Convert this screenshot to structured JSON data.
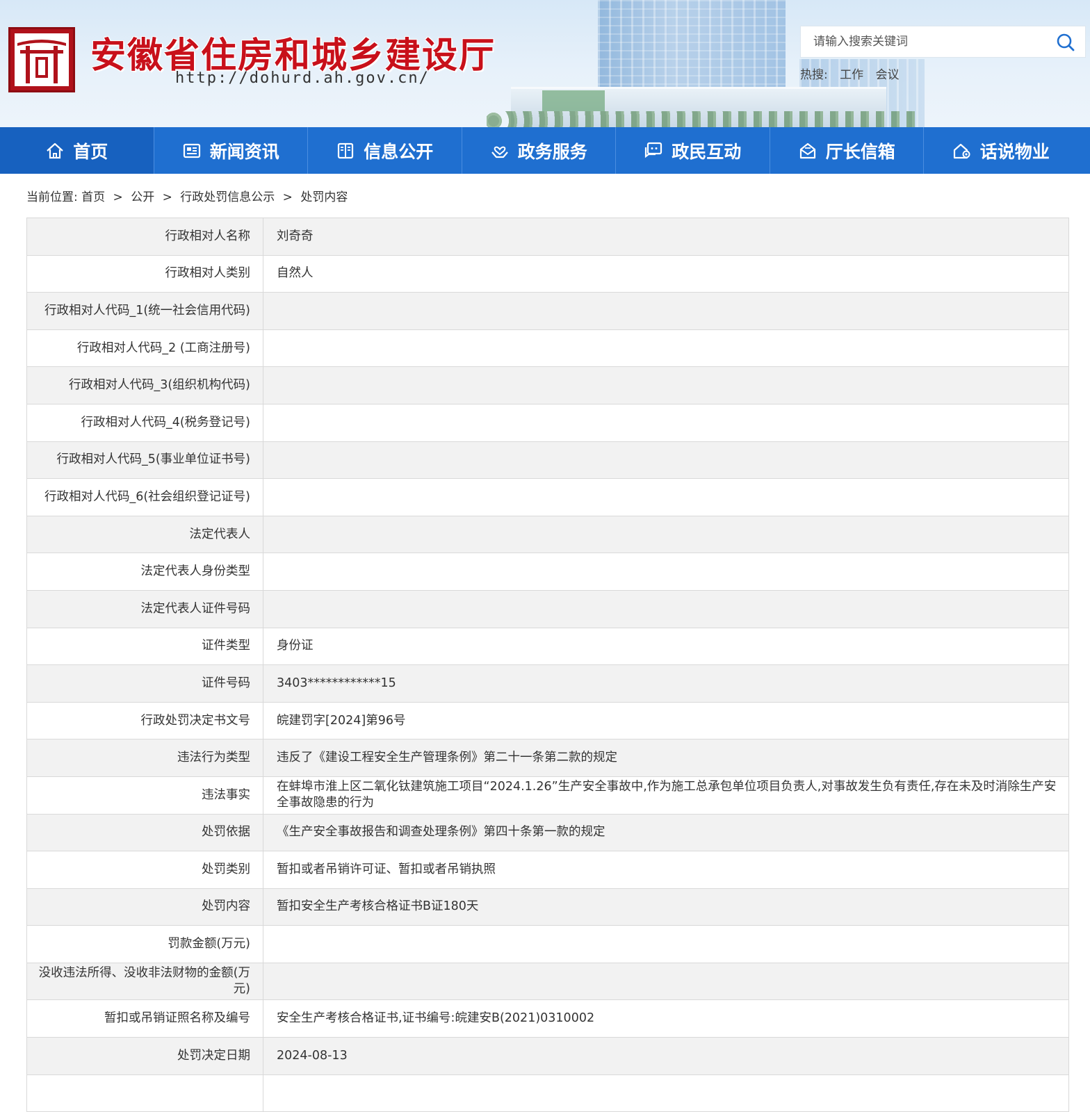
{
  "header": {
    "site_title": "安徽省住房和城乡建设厅",
    "site_url": "http://dohurd.ah.gov.cn/",
    "search_placeholder": "请输入搜索关键词",
    "hot_label": "热搜:",
    "hot_items": [
      "工作",
      "会议"
    ]
  },
  "nav": {
    "items": [
      {
        "label": "首页",
        "icon": "home-icon"
      },
      {
        "label": "新闻资讯",
        "icon": "news-icon"
      },
      {
        "label": "信息公开",
        "icon": "book-icon"
      },
      {
        "label": "政务服务",
        "icon": "service-hands-icon"
      },
      {
        "label": "政民互动",
        "icon": "chat-icon"
      },
      {
        "label": "厅长信箱",
        "icon": "mailbox-icon"
      },
      {
        "label": "话说物业",
        "icon": "property-icon"
      }
    ],
    "active_index": 0
  },
  "breadcrumb": {
    "prefix": "当前位置:",
    "items": [
      "首页",
      "公开",
      "行政处罚信息公示",
      "处罚内容"
    ],
    "separator": ">"
  },
  "table": {
    "rows": [
      {
        "label": "行政相对人名称",
        "value": "刘奇奇"
      },
      {
        "label": "行政相对人类别",
        "value": "自然人"
      },
      {
        "label": "行政相对人代码_1(统一社会信用代码)",
        "value": ""
      },
      {
        "label": "行政相对人代码_2 (工商注册号)",
        "value": ""
      },
      {
        "label": "行政相对人代码_3(组织机构代码)",
        "value": ""
      },
      {
        "label": "行政相对人代码_4(税务登记号)",
        "value": ""
      },
      {
        "label": "行政相对人代码_5(事业单位证书号)",
        "value": ""
      },
      {
        "label": "行政相对人代码_6(社会组织登记证号)",
        "value": ""
      },
      {
        "label": "法定代表人",
        "value": ""
      },
      {
        "label": "法定代表人身份类型",
        "value": ""
      },
      {
        "label": "法定代表人证件号码",
        "value": ""
      },
      {
        "label": "证件类型",
        "value": "身份证"
      },
      {
        "label": "证件号码",
        "value": "3403************15"
      },
      {
        "label": "行政处罚决定书文号",
        "value": "皖建罚字[2024]第96号"
      },
      {
        "label": "违法行为类型",
        "value": "违反了《建设工程安全生产管理条例》第二十一条第二款的规定"
      },
      {
        "label": "违法事实",
        "value": "在蚌埠市淮上区二氧化钛建筑施工项目“2024.1.26”生产安全事故中,作为施工总承包单位项目负责人,对事故发生负有责任,存在未及时消除生产安全事故隐患的行为"
      },
      {
        "label": "处罚依据",
        "value": "《生产安全事故报告和调查处理条例》第四十条第一款的规定"
      },
      {
        "label": "处罚类别",
        "value": "暂扣或者吊销许可证、暂扣或者吊销执照"
      },
      {
        "label": "处罚内容",
        "value": "暂扣安全生产考核合格证书B证180天"
      },
      {
        "label": "罚款金额(万元)",
        "value": ""
      },
      {
        "label": "没收违法所得、没收非法财物的金额(万元)",
        "value": ""
      },
      {
        "label": "暂扣或吊销证照名称及编号",
        "value": "安全生产考核合格证书,证书编号:皖建安B(2021)0310002"
      },
      {
        "label": "处罚决定日期",
        "value": "2024-08-13"
      },
      {
        "label": "",
        "value": ""
      }
    ]
  },
  "colors": {
    "nav_bg": "#1f6fd0",
    "title_red": "#c8101a",
    "logo_red": "#b0121b",
    "row_alt": "#f2f2f2",
    "border": "#d9d9d9"
  }
}
